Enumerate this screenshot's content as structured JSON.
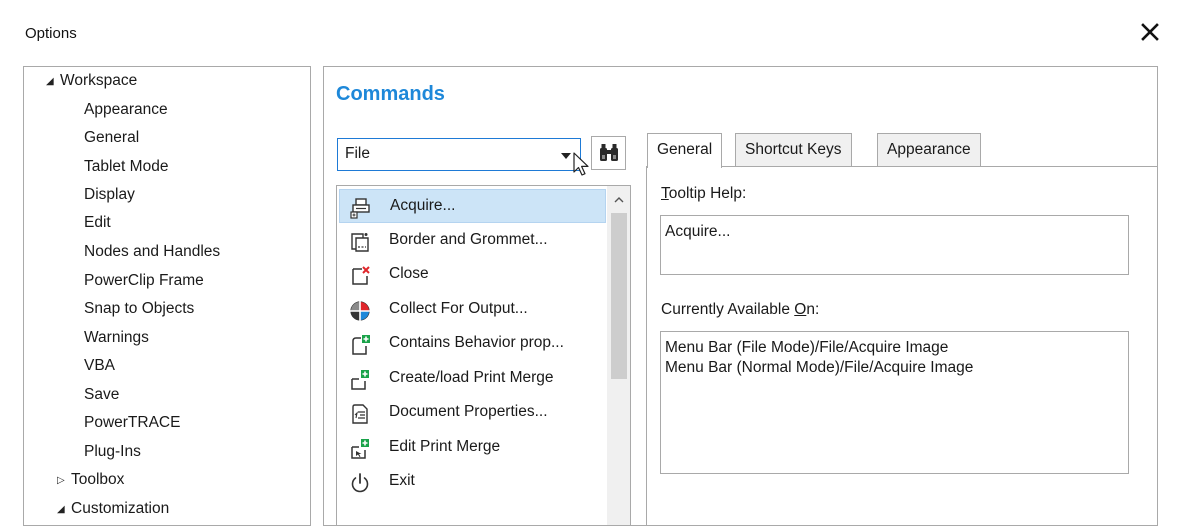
{
  "window": {
    "title": "Options"
  },
  "tree": {
    "items": [
      {
        "label": "Workspace",
        "caret": "expanded"
      },
      {
        "label": "Appearance"
      },
      {
        "label": "General"
      },
      {
        "label": "Tablet Mode"
      },
      {
        "label": "Display"
      },
      {
        "label": "Edit"
      },
      {
        "label": "Nodes and Handles"
      },
      {
        "label": "PowerClip Frame"
      },
      {
        "label": "Snap to Objects"
      },
      {
        "label": "Warnings"
      },
      {
        "label": "VBA"
      },
      {
        "label": "Save"
      },
      {
        "label": "PowerTRACE"
      },
      {
        "label": "Plug-Ins"
      },
      {
        "label": "Toolbox",
        "caret": "collapsed"
      },
      {
        "label": "Customization",
        "caret": "expanded"
      }
    ]
  },
  "commands": {
    "title": "Commands",
    "category": "File",
    "items": [
      {
        "label": "Acquire...",
        "icon": "scanner-icon",
        "selected": true
      },
      {
        "label": "Border and Grommet...",
        "icon": "grommet-icon"
      },
      {
        "label": "Close",
        "icon": "close-document-icon"
      },
      {
        "label": "Collect For Output...",
        "icon": "collect-output-icon"
      },
      {
        "label": "Contains Behavior prop...",
        "icon": "behavior-icon"
      },
      {
        "label": "Create/load Print Merge",
        "icon": "print-merge-icon"
      },
      {
        "label": "Document Properties...",
        "icon": "document-properties-icon"
      },
      {
        "label": "Edit Print Merge",
        "icon": "edit-print-merge-icon"
      },
      {
        "label": "Exit",
        "icon": "power-icon"
      }
    ]
  },
  "tabs": [
    {
      "label": "General",
      "active": true
    },
    {
      "label": "Shortcut Keys"
    },
    {
      "label": "Appearance"
    }
  ],
  "general": {
    "tooltip_label_key": "T",
    "tooltip_label_rest": "ooltip Help:",
    "tooltip_value": "Acquire...",
    "available_label_start": "Currently Available ",
    "available_label_key": "O",
    "available_label_end": "n:",
    "available_value": "Menu Bar (File Mode)/File/Acquire Image\nMenu Bar (Normal Mode)/File/Acquire Image"
  },
  "colors": {
    "accent": "#1e88d9",
    "selection": "#cce4f7",
    "border": "#a9a9a9",
    "plus": "#1aa34a",
    "cross": "#e0262b"
  }
}
